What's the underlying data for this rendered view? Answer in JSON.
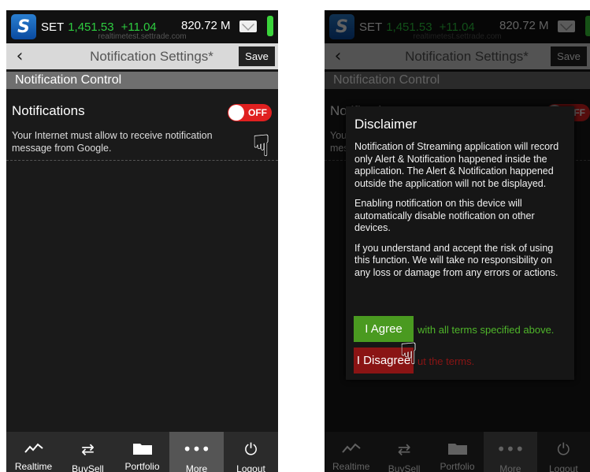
{
  "status": {
    "logo": "S",
    "market": "SET",
    "index": "1,451.53",
    "change": "+11.04",
    "volume": "820.72 M",
    "url": "realtimetest.settrade.com"
  },
  "nav": {
    "back_icon": "chevron-left",
    "title": "Notification Settings*",
    "save_label": "Save"
  },
  "section_title": "Notification Control",
  "notifications": {
    "label": "Notifications",
    "toggle_state": "OFF",
    "description": "Your Internet must allow to receive notification message from Google."
  },
  "dialog": {
    "title": "Disclaimer",
    "paragraphs": [
      "Notification of Streaming application will record only Alert & Notification happened inside the application. The Alert & Notification happened outside the application will not be displayed.",
      "Enabling notification on this device will automatically disable notification on other devices.",
      "If you understand and accept the risk of using this function. We will take no responsibility on any loss or damage from any errors or actions."
    ],
    "agree_label": "I Agree",
    "agree_text": "with all terms specified above.",
    "disagree_label": "I Disagree",
    "disagree_text": "ut the terms."
  },
  "tabs": [
    {
      "label": "Realtime",
      "icon": "chart-line-icon"
    },
    {
      "label": "BuySell",
      "icon": "swap-arrows-icon"
    },
    {
      "label": "Portfolio",
      "icon": "folder-icon"
    },
    {
      "label": "More",
      "icon": "more-dots-icon"
    },
    {
      "label": "Logout",
      "icon": "power-icon"
    }
  ],
  "colors": {
    "positive": "#2ecc40",
    "toggle_off": "#e02020",
    "agree": "#4a9a20",
    "disagree": "#8a1414"
  }
}
